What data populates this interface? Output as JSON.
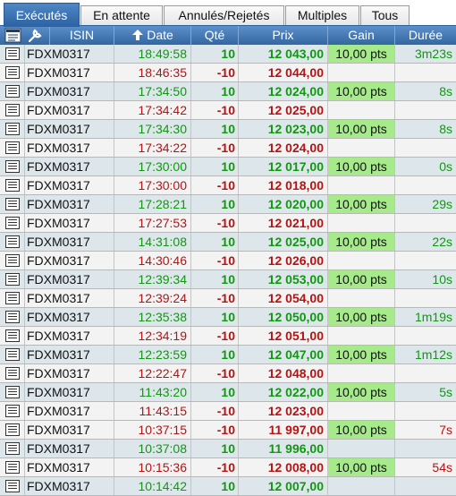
{
  "tabs": [
    {
      "label": "Exécutés",
      "active": true
    },
    {
      "label": "En attente",
      "active": false
    },
    {
      "label": "Annulés/Rejetés",
      "active": false
    },
    {
      "label": "Multiples",
      "active": false
    },
    {
      "label": "Tous",
      "active": false
    }
  ],
  "columns": {
    "isin": "ISIN",
    "date": "Date",
    "qty": "Qté",
    "prix": "Prix",
    "gain": "Gain",
    "duree": "Durée"
  },
  "header_icons": [
    "document-icon",
    "wrench-icon",
    "sort-up-arrow-icon"
  ],
  "colors": {
    "accent": "#2c61a2",
    "buy_text": "#119711",
    "sell_text": "#b51313",
    "gain_bg": "#a6ea8c",
    "buy_row_bg": "#dde6ea",
    "sell_row_bg": "#f3f3f3"
  },
  "rows": [
    {
      "isin": "FDXM0317",
      "date": "18:49:58",
      "qty": "10",
      "prix": "12 043,00",
      "gain": "10,00 pts",
      "duree": "3m23s",
      "side": "buy",
      "dur_color": "pos"
    },
    {
      "isin": "FDXM0317",
      "date": "18:46:35",
      "qty": "-10",
      "prix": "12 044,00",
      "gain": "",
      "duree": "",
      "side": "sell",
      "dur_color": ""
    },
    {
      "isin": "FDXM0317",
      "date": "17:34:50",
      "qty": "10",
      "prix": "12 024,00",
      "gain": "10,00 pts",
      "duree": "8s",
      "side": "buy",
      "dur_color": "pos"
    },
    {
      "isin": "FDXM0317",
      "date": "17:34:42",
      "qty": "-10",
      "prix": "12 025,00",
      "gain": "",
      "duree": "",
      "side": "sell",
      "dur_color": ""
    },
    {
      "isin": "FDXM0317",
      "date": "17:34:30",
      "qty": "10",
      "prix": "12 023,00",
      "gain": "10,00 pts",
      "duree": "8s",
      "side": "buy",
      "dur_color": "pos"
    },
    {
      "isin": "FDXM0317",
      "date": "17:34:22",
      "qty": "-10",
      "prix": "12 024,00",
      "gain": "",
      "duree": "",
      "side": "sell",
      "dur_color": ""
    },
    {
      "isin": "FDXM0317",
      "date": "17:30:00",
      "qty": "10",
      "prix": "12 017,00",
      "gain": "10,00 pts",
      "duree": "0s",
      "side": "buy",
      "dur_color": "pos"
    },
    {
      "isin": "FDXM0317",
      "date": "17:30:00",
      "qty": "-10",
      "prix": "12 018,00",
      "gain": "",
      "duree": "",
      "side": "sell",
      "dur_color": ""
    },
    {
      "isin": "FDXM0317",
      "date": "17:28:21",
      "qty": "10",
      "prix": "12 020,00",
      "gain": "10,00 pts",
      "duree": "29s",
      "side": "buy",
      "dur_color": "pos"
    },
    {
      "isin": "FDXM0317",
      "date": "17:27:53",
      "qty": "-10",
      "prix": "12 021,00",
      "gain": "",
      "duree": "",
      "side": "sell",
      "dur_color": ""
    },
    {
      "isin": "FDXM0317",
      "date": "14:31:08",
      "qty": "10",
      "prix": "12 025,00",
      "gain": "10,00 pts",
      "duree": "22s",
      "side": "buy",
      "dur_color": "pos"
    },
    {
      "isin": "FDXM0317",
      "date": "14:30:46",
      "qty": "-10",
      "prix": "12 026,00",
      "gain": "",
      "duree": "",
      "side": "sell",
      "dur_color": ""
    },
    {
      "isin": "FDXM0317",
      "date": "12:39:34",
      "qty": "10",
      "prix": "12 053,00",
      "gain": "10,00 pts",
      "duree": "10s",
      "side": "buy",
      "dur_color": "pos"
    },
    {
      "isin": "FDXM0317",
      "date": "12:39:24",
      "qty": "-10",
      "prix": "12 054,00",
      "gain": "",
      "duree": "",
      "side": "sell",
      "dur_color": ""
    },
    {
      "isin": "FDXM0317",
      "date": "12:35:38",
      "qty": "10",
      "prix": "12 050,00",
      "gain": "10,00 pts",
      "duree": "1m19s",
      "side": "buy",
      "dur_color": "pos"
    },
    {
      "isin": "FDXM0317",
      "date": "12:34:19",
      "qty": "-10",
      "prix": "12 051,00",
      "gain": "",
      "duree": "",
      "side": "sell",
      "dur_color": ""
    },
    {
      "isin": "FDXM0317",
      "date": "12:23:59",
      "qty": "10",
      "prix": "12 047,00",
      "gain": "10,00 pts",
      "duree": "1m12s",
      "side": "buy",
      "dur_color": "pos"
    },
    {
      "isin": "FDXM0317",
      "date": "12:22:47",
      "qty": "-10",
      "prix": "12 048,00",
      "gain": "",
      "duree": "",
      "side": "sell",
      "dur_color": ""
    },
    {
      "isin": "FDXM0317",
      "date": "11:43:20",
      "qty": "10",
      "prix": "12 022,00",
      "gain": "10,00 pts",
      "duree": "5s",
      "side": "buy",
      "dur_color": "pos"
    },
    {
      "isin": "FDXM0317",
      "date": "11:43:15",
      "qty": "-10",
      "prix": "12 023,00",
      "gain": "",
      "duree": "",
      "side": "sell",
      "dur_color": ""
    },
    {
      "isin": "FDXM0317",
      "date": "10:37:15",
      "qty": "-10",
      "prix": "11 997,00",
      "gain": "10,00 pts",
      "duree": "7s",
      "side": "sell",
      "dur_color": "neg"
    },
    {
      "isin": "FDXM0317",
      "date": "10:37:08",
      "qty": "10",
      "prix": "11 996,00",
      "gain": "",
      "duree": "",
      "side": "buy",
      "dur_color": ""
    },
    {
      "isin": "FDXM0317",
      "date": "10:15:36",
      "qty": "-10",
      "prix": "12 008,00",
      "gain": "10,00 pts",
      "duree": "54s",
      "side": "sell",
      "dur_color": "neg"
    },
    {
      "isin": "FDXM0317",
      "date": "10:14:42",
      "qty": "10",
      "prix": "12 007,00",
      "gain": "",
      "duree": "",
      "side": "buy",
      "dur_color": ""
    }
  ]
}
